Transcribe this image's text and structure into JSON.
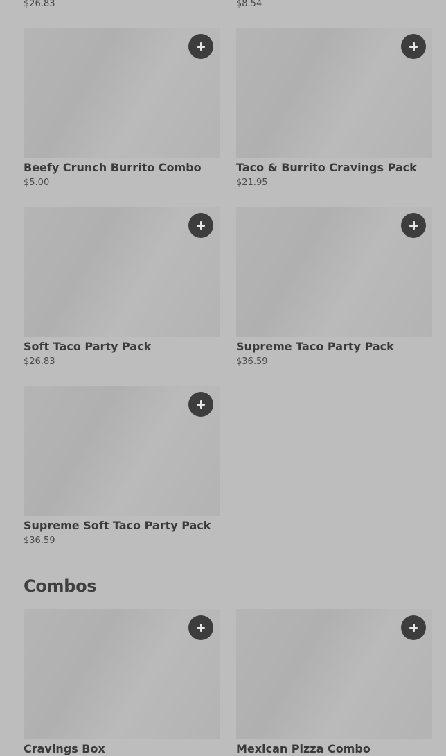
{
  "top_prices": [
    "$26.83",
    "$8.54"
  ],
  "items_section": {
    "items": [
      {
        "name": "Beefy Crunch Burrito Combo",
        "price": "$5.00"
      },
      {
        "name": "Taco & Burrito Cravings Pack",
        "price": "$21.95"
      },
      {
        "name": "Soft Taco Party Pack",
        "price": "$26.83"
      },
      {
        "name": "Supreme Taco Party Pack",
        "price": "$36.59"
      },
      {
        "name": "Supreme Soft Taco Party Pack",
        "price": "$36.59"
      }
    ]
  },
  "combos_section": {
    "title": "Combos",
    "items": [
      {
        "name": "Cravings Box"
      },
      {
        "name": "Mexican Pizza Combo"
      }
    ]
  },
  "icons": {
    "add": "plus-icon"
  },
  "colors": {
    "background": "#bdbdbd",
    "image_placeholder": "#b3b3b3",
    "add_button": "#3d3d3d",
    "text": "#3a3a3a"
  }
}
